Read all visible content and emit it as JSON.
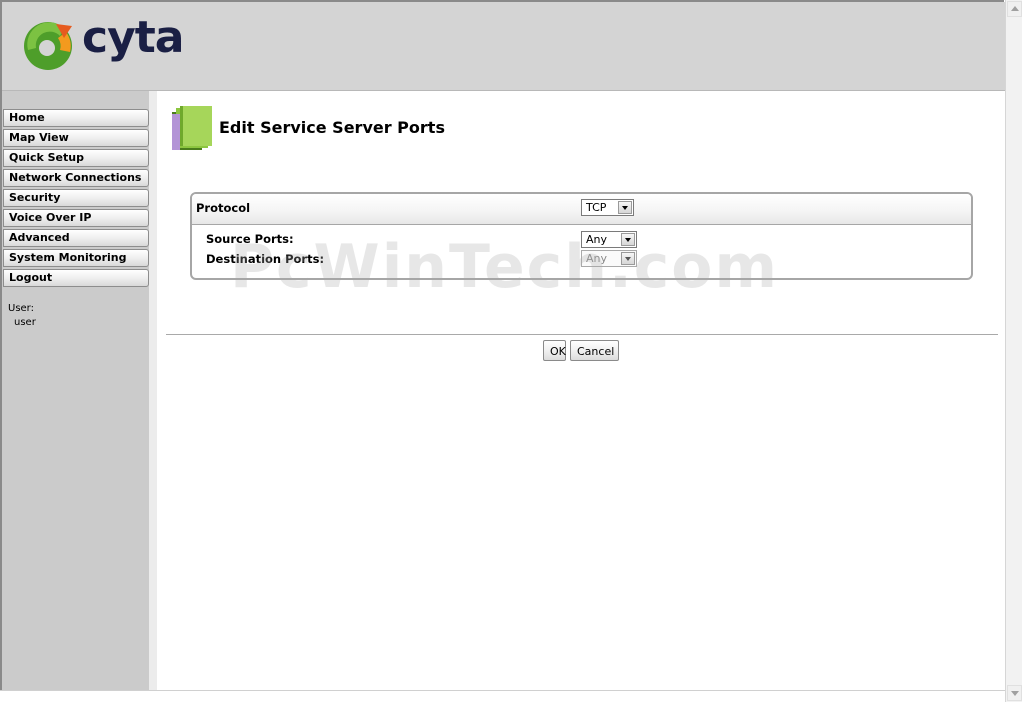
{
  "brand": {
    "name": "cyta",
    "colors": {
      "swirl_green": "#5aa832",
      "swirl_orange": "#f39a1e",
      "wordmark": "#1a1f44"
    }
  },
  "sidebar": {
    "items": [
      {
        "label": "Home"
      },
      {
        "label": "Map View"
      },
      {
        "label": "Quick Setup"
      },
      {
        "label": "Network Connections"
      },
      {
        "label": "Security"
      },
      {
        "label": "Voice Over IP"
      },
      {
        "label": "Advanced"
      },
      {
        "label": "System Monitoring"
      },
      {
        "label": "Logout"
      }
    ],
    "user_label": "User:",
    "user_value": "user"
  },
  "page": {
    "title": "Edit Service Server Ports",
    "icon": "folder-book-icon"
  },
  "form": {
    "protocol_label": "Protocol",
    "protocol_value": "TCP",
    "source_ports_label": "Source Ports:",
    "source_ports_value": "Any",
    "destination_ports_label": "Destination Ports:",
    "destination_ports_value": "Any"
  },
  "watermark": "PcWinTech.com",
  "buttons": {
    "ok": "OK",
    "cancel": "Cancel"
  }
}
